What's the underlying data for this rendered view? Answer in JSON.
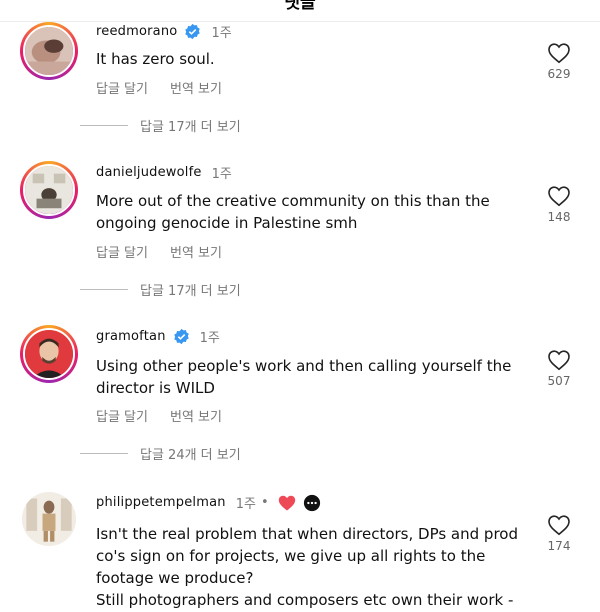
{
  "header": {
    "title": "댓글"
  },
  "comments": [
    {
      "username": "reedmorano",
      "time": "1주",
      "text": "It has zero soul.",
      "actions": {
        "reply": "답글 달기",
        "translate": "번역 보기"
      },
      "likes": "629",
      "view_replies": "답글 17개 더 보기"
    },
    {
      "username": "danieljudewolfe",
      "time": "1주",
      "text": "More out of the creative community on this than the ongoing genocide in Palestine smh",
      "actions": {
        "reply": "답글 달기",
        "translate": "번역 보기"
      },
      "likes": "148",
      "view_replies": "답글 17개 더 보기"
    },
    {
      "username": "gramoftan",
      "time": "1주",
      "text": "Using other people's work and then calling yourself the director is WILD",
      "actions": {
        "reply": "답글 달기",
        "translate": "번역 보기"
      },
      "likes": "507",
      "view_replies": "답글 24개 더 보기"
    },
    {
      "username": "philippetempelman",
      "time": "1주",
      "dot": "•",
      "text_lines": [
        "Isn't the real problem that when directors, DPs and prod",
        "co's sign on for projects, we give up all rights to the",
        "footage we produce?",
        "Still photographers and composers etc own their work - we"
      ],
      "likes": "174"
    }
  ],
  "icons": {
    "like": "heart-outline-icon",
    "verified": "verified-badge-icon",
    "creator_like": "red-heart-icon",
    "more": "more-dots-icon"
  },
  "colors": {
    "verified": "#3897f0",
    "heart_red": "#ed4956",
    "secondary_text": "#777777"
  }
}
